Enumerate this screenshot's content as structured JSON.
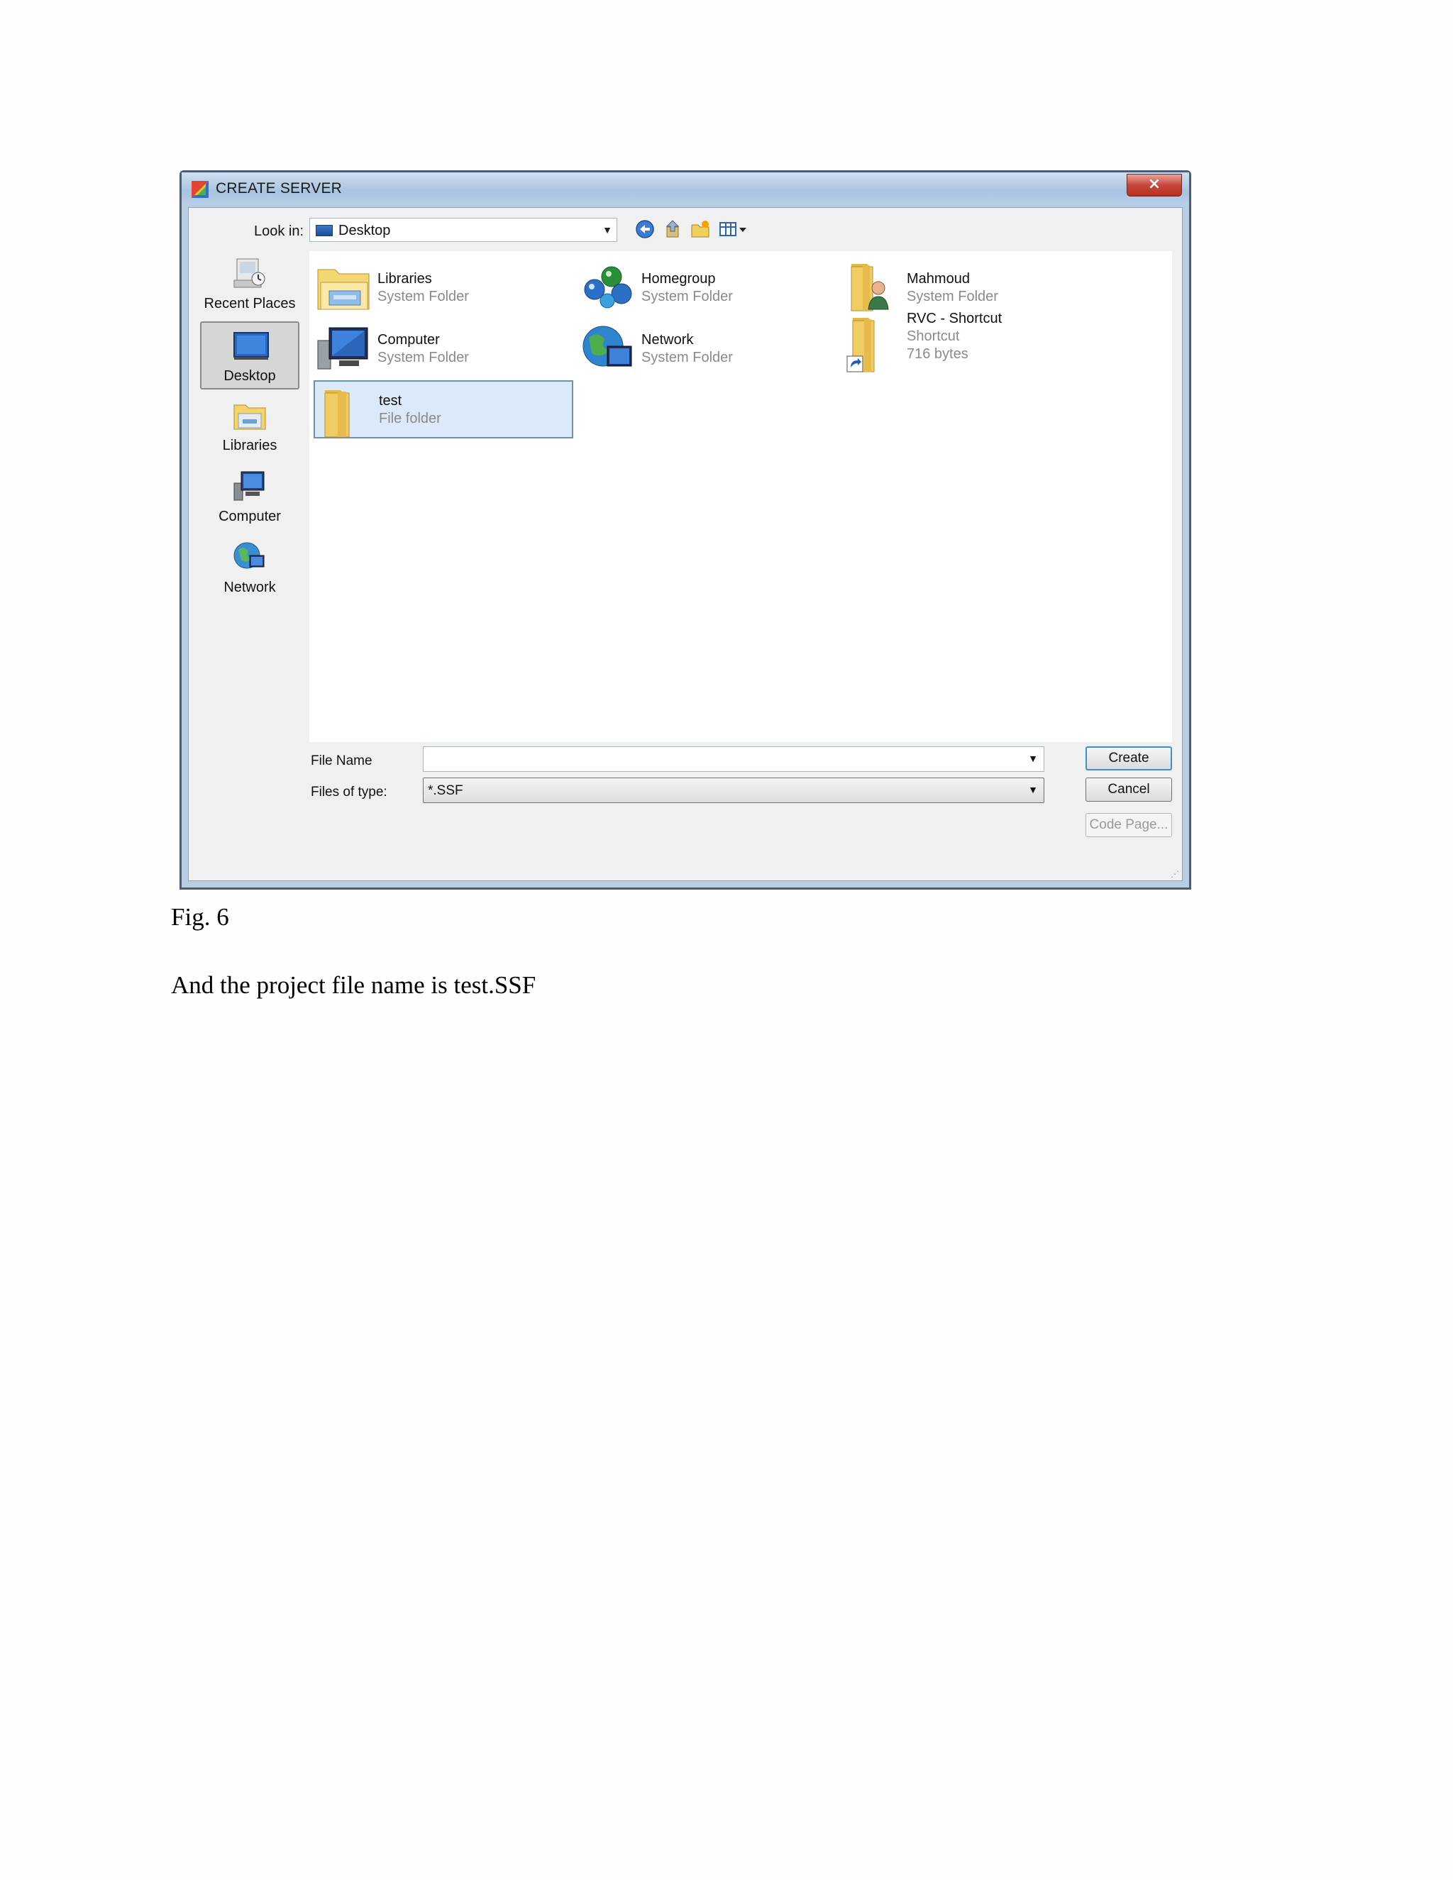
{
  "window": {
    "title": "CREATE SERVER",
    "close_label": "×"
  },
  "toolbar": {
    "lookin_label": "Look in:",
    "lookin_value": "Desktop",
    "icons": [
      "back-icon",
      "up-folder-icon",
      "new-folder-icon",
      "views-icon"
    ]
  },
  "places": [
    {
      "label": "Recent Places",
      "icon": "recent-places-icon"
    },
    {
      "label": "Desktop",
      "icon": "desktop-icon",
      "selected": true
    },
    {
      "label": "Libraries",
      "icon": "libraries-icon"
    },
    {
      "label": "Computer",
      "icon": "computer-icon"
    },
    {
      "label": "Network",
      "icon": "network-icon"
    }
  ],
  "files": [
    {
      "name": "Libraries",
      "type": "System Folder",
      "icon": "libraries-icon"
    },
    {
      "name": "Homegroup",
      "type": "System Folder",
      "icon": "homegroup-icon"
    },
    {
      "name": "Mahmoud",
      "type": "System Folder",
      "icon": "user-folder-icon"
    },
    {
      "name": "Computer",
      "type": "System Folder",
      "icon": "computer-icon"
    },
    {
      "name": "Network",
      "type": "System Folder",
      "icon": "network-icon"
    },
    {
      "name": "RVC - Shortcut",
      "type": "Shortcut",
      "size": "716 bytes",
      "icon": "shortcut-folder-icon"
    },
    {
      "name": "test",
      "type": "File folder",
      "icon": "folder-icon",
      "selected": true
    }
  ],
  "fields": {
    "filename_label": "File Name",
    "filename_value": "",
    "filetype_label": "Files of type:",
    "filetype_value": "*.SSF"
  },
  "buttons": {
    "create": "Create",
    "cancel": "Cancel",
    "codepage": "Code Page..."
  },
  "document": {
    "caption": "Fig. 6",
    "body": "And the project file name is test.SSF"
  },
  "colors": {
    "title_bar": "#b9cde3",
    "selection": "#dbe9f9",
    "close_button": "#c8453a",
    "default_button_border": "#3d8fd0"
  }
}
